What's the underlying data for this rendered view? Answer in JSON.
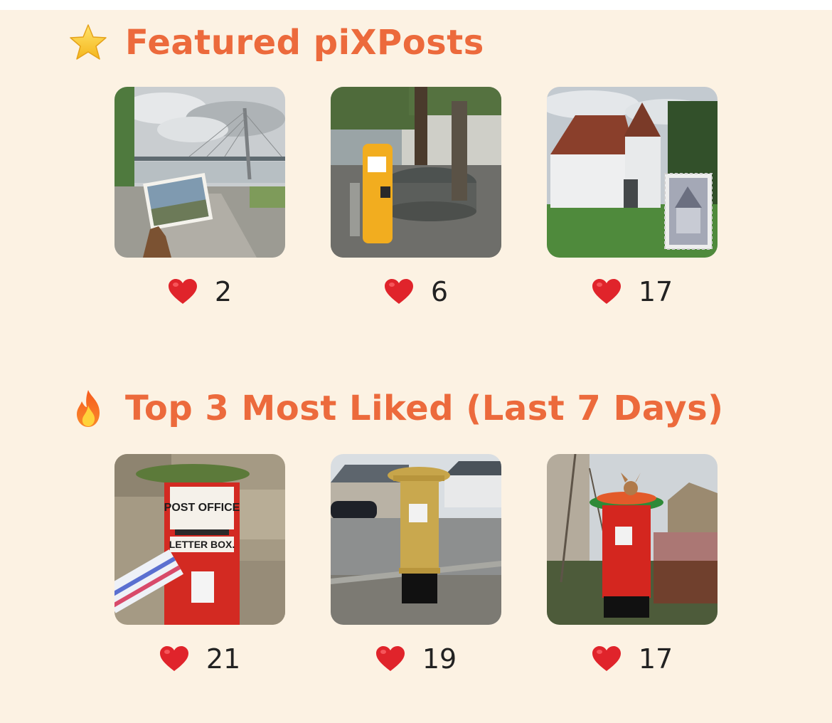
{
  "sections": [
    {
      "icon": "star-icon",
      "title": "Featured piXPosts",
      "posts": [
        {
          "scene": "bridge-postcard",
          "likes": "2"
        },
        {
          "scene": "yellow-postbox-fountain",
          "likes": "6"
        },
        {
          "scene": "white-castle-stamp",
          "likes": "17"
        }
      ]
    },
    {
      "icon": "fire-icon",
      "title": "Top 3 Most Liked (Last 7 Days)",
      "posts": [
        {
          "scene": "red-wall-letter-box",
          "likes": "21"
        },
        {
          "scene": "gold-pillar-box",
          "likes": "19"
        },
        {
          "scene": "red-pillar-box-knitted-topper",
          "likes": "17"
        }
      ]
    }
  ],
  "colors": {
    "background": "#fcf2e3",
    "title": "#ec6a3c",
    "heart": "#e0242b"
  }
}
